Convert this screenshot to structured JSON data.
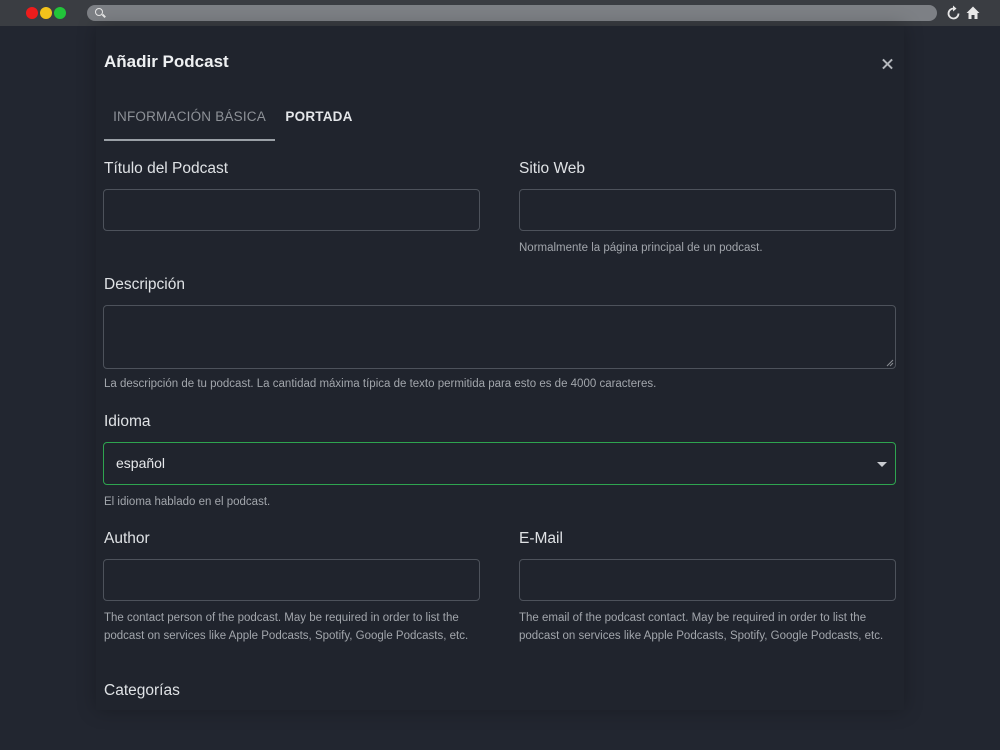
{
  "modal": {
    "title": "Añadir Podcast",
    "tabs": [
      {
        "label": "INFORMACIÓN BÁSICA",
        "active": true
      },
      {
        "label": "PORTADA",
        "active": false
      }
    ]
  },
  "form": {
    "title_label": "Título del Podcast",
    "title_value": "",
    "website_label": "Sitio Web",
    "website_value": "",
    "website_hint": "Normalmente la página principal de un podcast.",
    "description_label": "Descripción",
    "description_value": "",
    "description_hint": "La descripción de tu podcast. La cantidad máxima típica de texto permitida para esto es de 4000 caracteres.",
    "language_label": "Idioma",
    "language_value": "español",
    "language_hint": "El idioma hablado en el podcast.",
    "author_label": "Author",
    "author_value": "",
    "author_hint": "The contact person of the podcast. May be required in order to list the podcast on services like Apple Podcasts, Spotify, Google Podcasts, etc.",
    "email_label": "E-Mail",
    "email_value": "",
    "email_hint": "The email of the podcast contact. May be required in order to list the podcast on services like Apple Podcasts, Spotify, Google Podcasts, etc.",
    "categories_label": "Categorías"
  },
  "colors": {
    "accent_focus": "#2ea44f",
    "background": "#222630",
    "modal_bg": "#20242d"
  },
  "icons": {
    "close": "close-icon",
    "dropdown": "chevron-down-icon",
    "reload": "reload-icon",
    "home": "home-icon",
    "search": "search-icon"
  }
}
